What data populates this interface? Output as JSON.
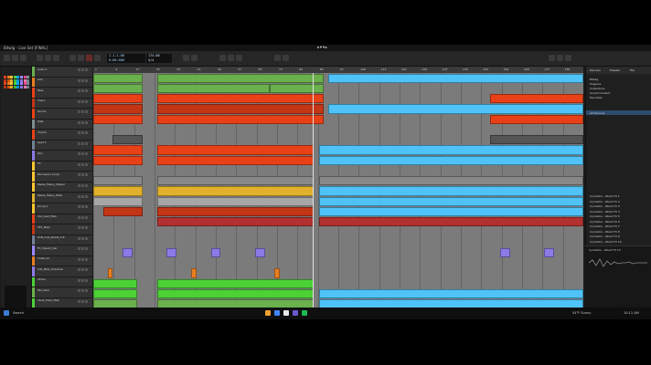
{
  "window": {
    "title": "Bitwig - Live Set [FINAL]"
  },
  "toolbar": {
    "position": "1.1.1.00",
    "tempo": "174.00",
    "time": "0:00.000",
    "time_sig": "4/4"
  },
  "ruler": {
    "markers": [
      "1",
      "9",
      "17",
      "25",
      "33",
      "41",
      "49",
      "57",
      "65",
      "73",
      "81",
      "89",
      "97",
      "105",
      "113",
      "121",
      "129",
      "137",
      "145",
      "153",
      "161",
      "169",
      "177",
      "185"
    ]
  },
  "tracks": [
    {
      "name": "Audio 1",
      "color": "#6ab04c"
    },
    {
      "name": "Kick",
      "color": "#e67e22"
    },
    {
      "name": "Bass",
      "color": "#e84118"
    },
    {
      "name": "Snare",
      "color": "#c23616"
    },
    {
      "name": "Drums",
      "color": "#e84118"
    },
    {
      "name": "Hats",
      "color": "#7f8c8d"
    },
    {
      "name": "Chords",
      "color": "#e84118"
    },
    {
      "name": "Lead 1",
      "color": "#718093"
    },
    {
      "name": "Perc",
      "color": "#8c7ae6"
    },
    {
      "name": "FX",
      "color": "#fbc531"
    },
    {
      "name": "Percussion Loops",
      "color": "#fbc531"
    },
    {
      "name": "Reese_Heavy_Shaper",
      "color": "#fbc531"
    },
    {
      "name": "Reese_Heavy_Wide",
      "color": "#e1b12c"
    },
    {
      "name": "Group 2",
      "color": "#fbc531"
    },
    {
      "name": "Vox_Lead_Main",
      "color": "#e84118"
    },
    {
      "name": "SFX_Riser",
      "color": "#c23616"
    },
    {
      "name": "DnB_Loop_Break_Cut",
      "color": "#718093"
    },
    {
      "name": "FX_Impact_Sub",
      "color": "#9c88ff"
    },
    {
      "name": "Crash_01",
      "color": "#e67e22"
    },
    {
      "name": "Sub_Bass_Sidechain",
      "color": "#8c7ae6"
    },
    {
      "name": "Atmos",
      "color": "#4cd137"
    },
    {
      "name": "Pad_Dark",
      "color": "#6ab04c"
    },
    {
      "name": "Vocal_Chop_Main",
      "color": "#4cd137"
    },
    {
      "name": "Master",
      "color": "#718093"
    }
  ],
  "browser": {
    "tabs": [
      "Devices",
      "Presets",
      "File"
    ],
    "items": [
      "Bitwig",
      "Pluginss",
      "Collections",
      "Sound Content",
      "Favorites"
    ],
    "selected": "All Devices",
    "results": [
      "Cymatics - Wood FX 1",
      "Cymatics - Wood FX 2",
      "Cymatics - Wood FX 3",
      "Cymatics - Wood FX 4",
      "Cymatics - Wood FX 5",
      "Cymatics - Wood FX 6",
      "Cymatics - Wood FX 7",
      "Cymatics - Wood FX 8",
      "Cymatics - Wood FX 9",
      "Cymatics - Wood FX 10",
      "Cymatics - Wood FX 11",
      "Cymatics - Wood FX 12"
    ],
    "preview": "Cymatics - Wood FX 13"
  },
  "taskbar": {
    "search": "Search",
    "weather": "54°F Sunny",
    "clock": "10:11 AM"
  },
  "colors": {
    "accent": "#4fb8e8",
    "green": "#6ab04c",
    "orange": "#e84118",
    "cyan": "#4fc3f7"
  }
}
